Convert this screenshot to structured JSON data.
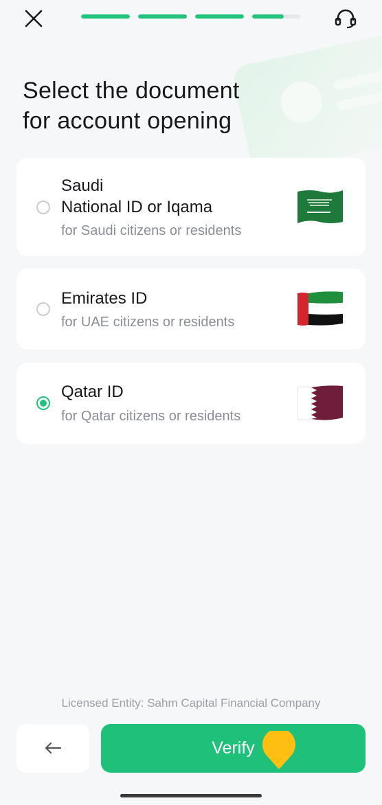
{
  "header": {
    "close_icon": "close-icon",
    "support_icon": "headset-icon",
    "progress_fills": [
      1,
      1,
      1,
      0.65
    ],
    "accent": "#22c37a"
  },
  "title": {
    "line1": "Select the document",
    "line2": "for account opening"
  },
  "options": [
    {
      "name_line1": "Saudi",
      "name_line2": "National ID or Iqama",
      "subtitle": "for Saudi citizens or residents",
      "selected": false,
      "flag": "saudi-flag"
    },
    {
      "name": "Emirates ID",
      "subtitle": "for UAE citizens or residents",
      "selected": false,
      "flag": "uae-flag"
    },
    {
      "name": "Qatar ID",
      "subtitle": "for Qatar citizens or residents",
      "selected": true,
      "flag": "qatar-flag"
    }
  ],
  "footer": {
    "license": "Licensed Entity: Sahm Capital Financial Company",
    "back_icon": "arrow-left-icon",
    "verify_label": "Verify",
    "pointer_icon": "pointer-marker-icon",
    "verify_color": "#1fc07a"
  }
}
